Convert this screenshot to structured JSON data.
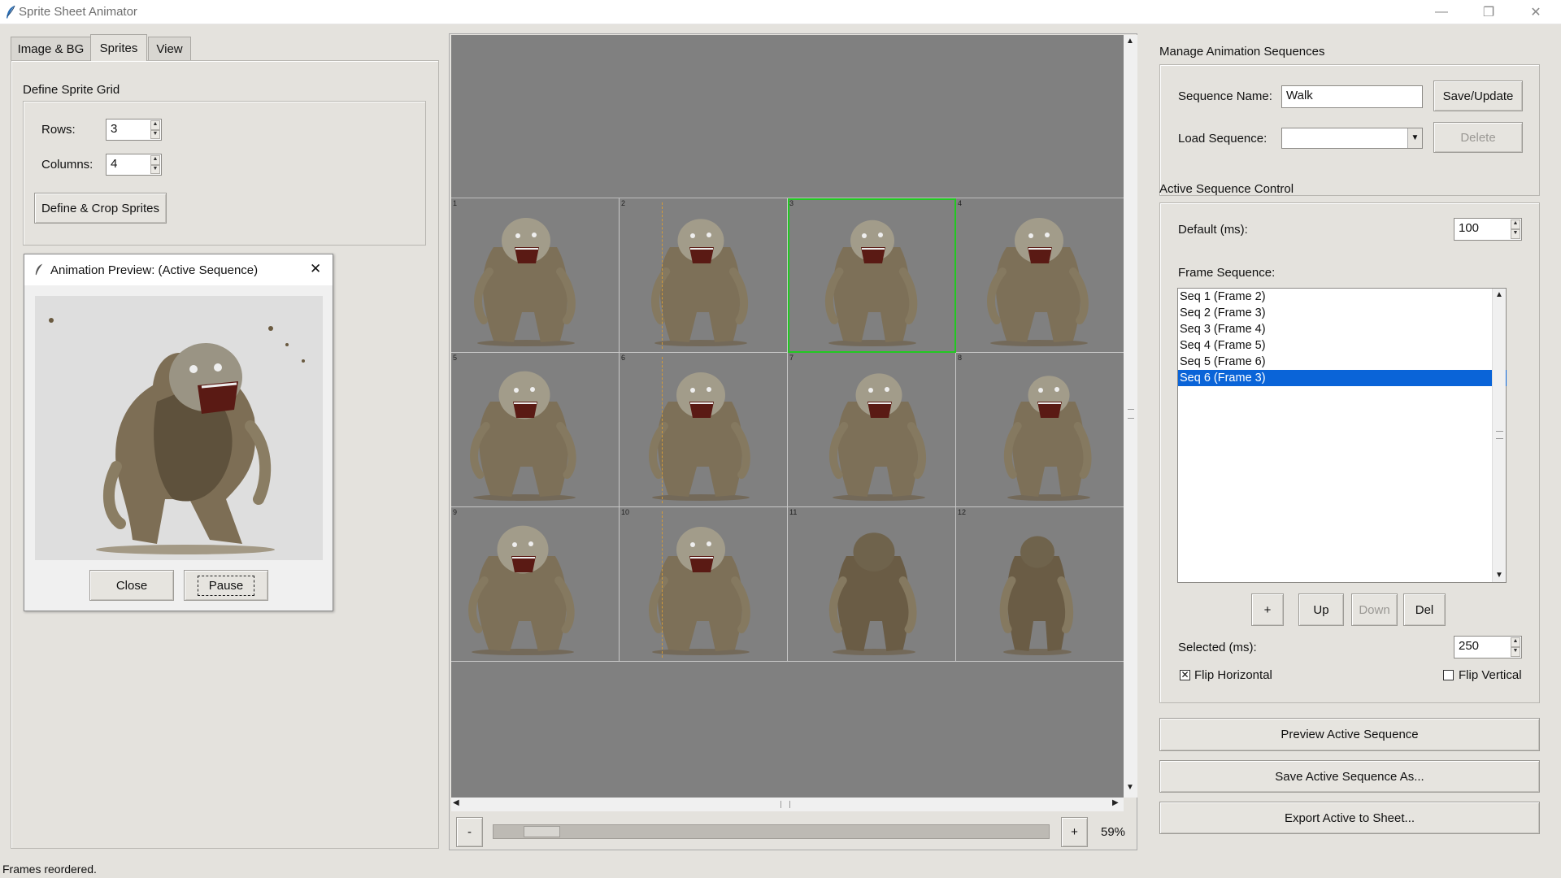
{
  "window": {
    "title": "Sprite Sheet Animator",
    "minimize": "—",
    "restore": "❐",
    "close": "✕"
  },
  "tabs": [
    {
      "label": "Image & BG",
      "active": false
    },
    {
      "label": "Sprites",
      "active": true
    },
    {
      "label": "View",
      "active": false
    }
  ],
  "grid_panel": {
    "title": "Define Sprite Grid",
    "rows_label": "Rows:",
    "rows_value": "3",
    "columns_label": "Columns:",
    "columns_value": "4",
    "define_button": "Define & Crop Sprites"
  },
  "preview": {
    "title": "Animation Preview: (Active Sequence)",
    "close_x": "✕",
    "close_button": "Close",
    "pause_button": "Pause"
  },
  "canvas": {
    "rows": 3,
    "columns": 4,
    "selected_cell": 3,
    "cell_indices": [
      "1",
      "2",
      "3",
      "4",
      "5",
      "6",
      "7",
      "8",
      "9",
      "10",
      "11",
      "12"
    ]
  },
  "zoom": {
    "minus": "-",
    "plus": "+",
    "level": "59%",
    "slider_position": 0.05
  },
  "manage": {
    "title": "Manage Animation Sequences",
    "seq_name_label": "Sequence Name:",
    "seq_name_value": "Walk",
    "save_button": "Save/Update",
    "load_label": "Load Sequence:",
    "load_value": "",
    "delete_button": "Delete"
  },
  "active": {
    "title": "Active Sequence Control",
    "default_label": "Default (ms):",
    "default_value": "100",
    "frame_seq_label": "Frame Sequence:",
    "frames": [
      "Seq 1 (Frame 2)",
      "Seq 2 (Frame 3)",
      "Seq 3 (Frame 4)",
      "Seq 4 (Frame 5)",
      "Seq 5 (Frame 6)",
      "Seq 6 (Frame 3)"
    ],
    "selected_index": 5,
    "add_button": "+",
    "up_button": "Up",
    "down_button": "Down",
    "del_button": "Del",
    "selected_label": "Selected (ms):",
    "selected_value": "250",
    "flip_h_label": "Flip Horizontal",
    "flip_h_checked": true,
    "flip_v_label": "Flip Vertical",
    "flip_v_checked": false
  },
  "actions": {
    "preview": "Preview Active Sequence",
    "save_as": "Save Active Sequence As...",
    "export": "Export Active to Sheet..."
  },
  "status": "Frames reordered.",
  "colors": {
    "selection_blue": "#0a64d8",
    "selected_cell_outline": "#22c822",
    "canvas_bg": "#808080"
  }
}
